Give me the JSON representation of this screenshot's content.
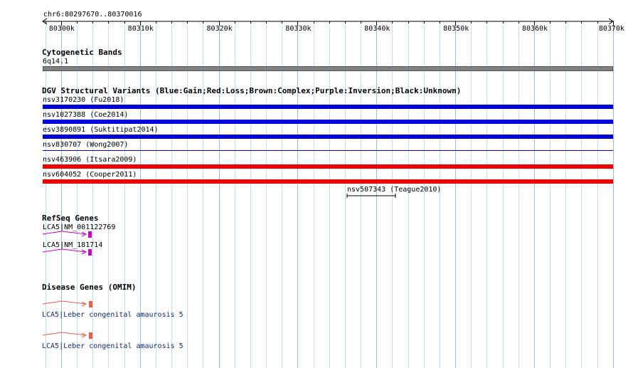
{
  "ruler": {
    "chrom_range": "chr6:80297670..80370016",
    "ticks": [
      "80300k",
      "80310k",
      "80320k",
      "80330k",
      "80340k",
      "80350k",
      "80360k",
      "80370k"
    ]
  },
  "cytoband": {
    "title": "Cytogenetic Bands",
    "band": "6q14.1"
  },
  "dgv": {
    "title": "DGV Structural Variants (Blue:Gain;Red:Loss;Brown:Complex;Purple:Inversion;Black:Unknown)",
    "variants": [
      {
        "label": "nsv3170230 (Fu2018)",
        "color": "#0000dd"
      },
      {
        "label": "nsv1027388 (Coe2014)",
        "color": "#0000dd"
      },
      {
        "label": "esv3890891 (Suktitipat2014)",
        "color": "#0000dd"
      },
      {
        "label": "nsv830707 (Wong2007)",
        "color": "#0000dd"
      },
      {
        "label": "nsv463906 (Itsara2009)",
        "color": "#ee0000"
      },
      {
        "label": "nsv604052 (Cooper2011)",
        "color": "#ee0000"
      },
      {
        "label": "nsv507343 (Teague2010)",
        "color": "#000000"
      }
    ]
  },
  "refseq": {
    "title": "RefSeq Genes",
    "genes": [
      {
        "label": "LCA5|NM_001122769",
        "color": "#cc00cc"
      },
      {
        "label": "LCA5|NM_181714",
        "color": "#cc00cc"
      }
    ]
  },
  "omim": {
    "title": "Disease Genes (OMIM)",
    "genes": [
      {
        "label": "LCA5|Leber congenital amaurosis 5",
        "color": "#e8604c"
      },
      {
        "label": "LCA5|Leber congenital amaurosis 5",
        "color": "#e8604c"
      }
    ]
  }
}
